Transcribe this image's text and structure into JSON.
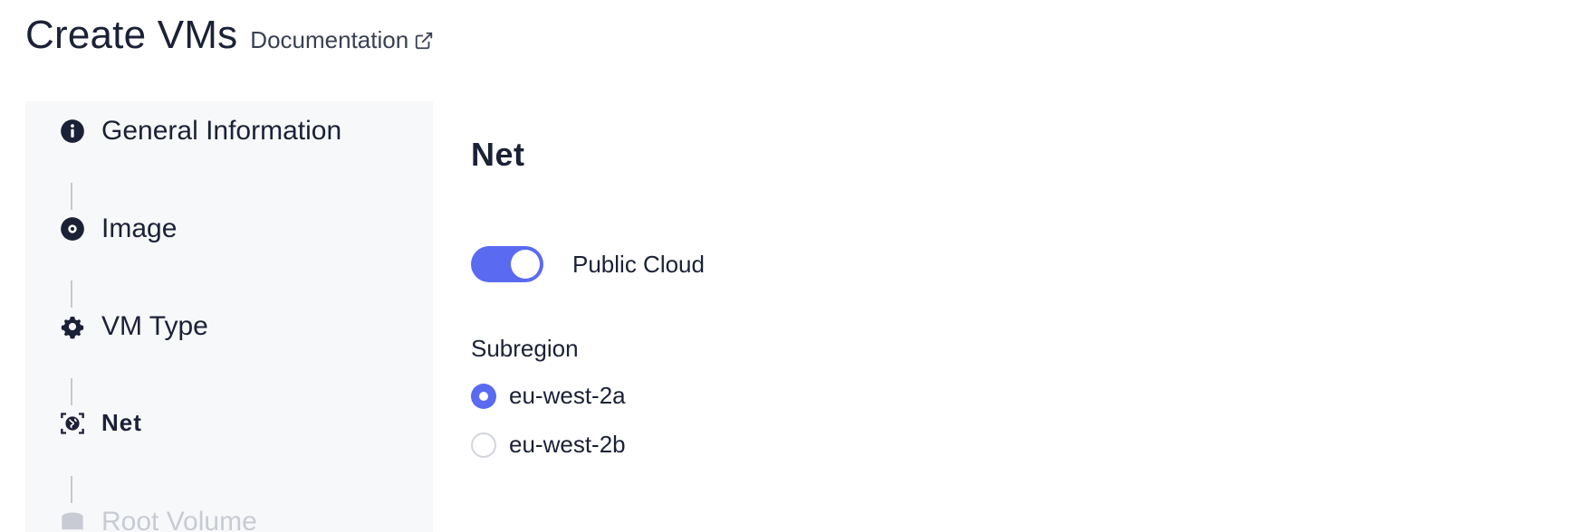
{
  "header": {
    "title": "Create VMs",
    "doc_link": "Documentation"
  },
  "sidebar": {
    "steps": [
      {
        "label": "General Information",
        "icon": "info-icon",
        "state": "done"
      },
      {
        "label": "Image",
        "icon": "disc-icon",
        "state": "done"
      },
      {
        "label": "VM Type",
        "icon": "gear-icon",
        "state": "done"
      },
      {
        "label": "Net",
        "icon": "globe-icon",
        "state": "active"
      },
      {
        "label": "Root Volume",
        "icon": "volume-icon",
        "state": "disabled"
      }
    ]
  },
  "main": {
    "section_title": "Net",
    "public_cloud": {
      "label": "Public Cloud",
      "enabled": true
    },
    "subregion": {
      "label": "Subregion",
      "options": [
        {
          "label": "eu-west-2a",
          "selected": true
        },
        {
          "label": "eu-west-2b",
          "selected": false
        }
      ]
    }
  },
  "colors": {
    "accent": "#5a6af1",
    "text": "#1b2136",
    "sidebar_bg": "#f7f8fa"
  }
}
